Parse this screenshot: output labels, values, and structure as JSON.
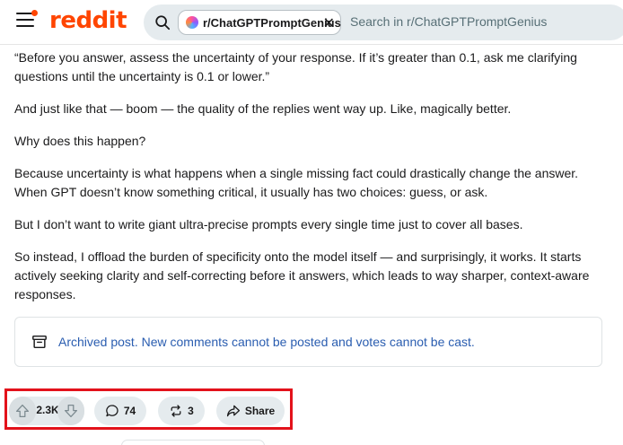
{
  "header": {
    "logo_text": "reddit",
    "community_chip": "r/ChatGPTPromptGenius",
    "search_placeholder": "Search in r/ChatGPTPromptGenius",
    "brand_color": "#ff4500"
  },
  "post": {
    "paragraphs": [
      "“Before you answer, assess the uncertainty of your response. If it’s greater than 0.1, ask me clarifying questions until the uncertainty is 0.1 or lower.”",
      "And just like that — boom — the quality of the replies went way up. Like, magically better.",
      "Why does this happen?",
      "Because uncertainty is what happens when a single missing fact could drastically change the answer. When GPT doesn’t know something critical, it usually has two choices: guess, or ask.",
      "But I don’t want to write giant ultra-precise prompts every single time just to cover all bases.",
      "So instead, I offload the burden of specificity onto the model itself — and surprisingly, it works. It starts actively seeking clarity and self-correcting before it answers, which leads to way sharper, context-aware responses."
    ],
    "archived_notice": "Archived post. New comments cannot be posted and votes cannot be cast."
  },
  "actions": {
    "vote_count": "2.3K",
    "comment_count": "74",
    "repost_count": "3",
    "share_label": "Share",
    "highlight_color": "#e3121b"
  },
  "icons": {
    "menu": "hamburger-icon",
    "search": "search-icon",
    "archive": "archive-icon",
    "upvote": "upvote-icon",
    "downvote": "downvote-icon",
    "comment": "comment-icon",
    "repost": "repost-icon",
    "share": "share-icon"
  }
}
